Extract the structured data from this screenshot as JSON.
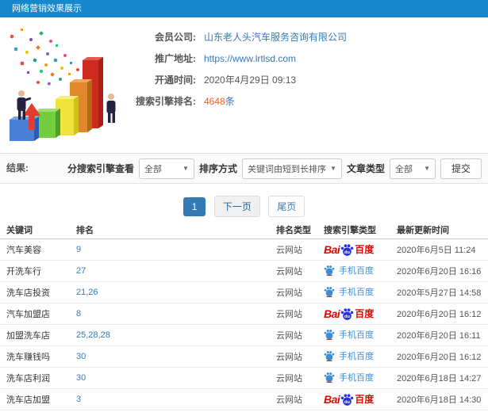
{
  "header": {
    "title": "网络营销效果展示"
  },
  "info": {
    "fields": [
      {
        "label": "会员公司:",
        "value": "山东老人头汽车服务咨询有限公司"
      },
      {
        "label": "推广地址:",
        "value": "https://www.lrtlsd.com"
      },
      {
        "label": "开通时间:",
        "value": "2020年4月29日 09:13"
      },
      {
        "label": "搜索引擎排名:",
        "count": "4648",
        "unit": "条"
      }
    ]
  },
  "filters": {
    "result_label": "结果:",
    "engine_view_label": "分搜索引擎查看",
    "engine_view_value": "全部",
    "sort_label": "排序方式",
    "sort_value": "关键词由短到长排序",
    "article_type_label": "文章类型",
    "article_type_value": "全部",
    "caret": "▼",
    "submit_label": "提交"
  },
  "pagination": {
    "current": "1",
    "next_label": "下一页",
    "last_label": "尾页"
  },
  "engines": {
    "baidu": {
      "prefix": "Bai",
      "du": "du",
      "suffix": "百度"
    },
    "mobile": {
      "label": "手机百度"
    }
  },
  "table": {
    "headers": [
      "关键词",
      "排名",
      "排名类型",
      "搜索引擎类型",
      "最新更新时间"
    ],
    "rows": [
      {
        "keyword": "汽车美容",
        "rank": "9",
        "rank_type": "云网站",
        "engine": "baidu",
        "updated": "2020年6月5日 11:24"
      },
      {
        "keyword": "开洗车行",
        "rank": "27",
        "rank_type": "云网站",
        "engine": "mobile",
        "updated": "2020年6月20日 16:16"
      },
      {
        "keyword": "洗车店投资",
        "rank": "21,26",
        "rank_type": "云网站",
        "engine": "mobile",
        "updated": "2020年5月27日 14:58"
      },
      {
        "keyword": "汽车加盟店",
        "rank": "8",
        "rank_type": "云网站",
        "engine": "baidu",
        "updated": "2020年6月20日 16:12"
      },
      {
        "keyword": "加盟洗车店",
        "rank": "25,28,28",
        "rank_type": "云网站",
        "engine": "mobile",
        "updated": "2020年6月20日 16:11"
      },
      {
        "keyword": "洗车赚钱吗",
        "rank": "30",
        "rank_type": "云网站",
        "engine": "mobile",
        "updated": "2020年6月20日 16:12"
      },
      {
        "keyword": "洗车店利润",
        "rank": "30",
        "rank_type": "云网站",
        "engine": "mobile",
        "updated": "2020年6月18日 14:27"
      },
      {
        "keyword": "洗车店加盟",
        "rank": "3",
        "rank_type": "云网站",
        "engine": "baidu",
        "updated": "2020年6月18日 14:30"
      }
    ]
  },
  "colors": {
    "header_bg": "#1787cd",
    "link": "#337ab7",
    "count": "#f65a1d",
    "baidu_red": "#e10601",
    "baidu_blue": "#2932e1",
    "mobile_blue": "#3d8cd7"
  }
}
